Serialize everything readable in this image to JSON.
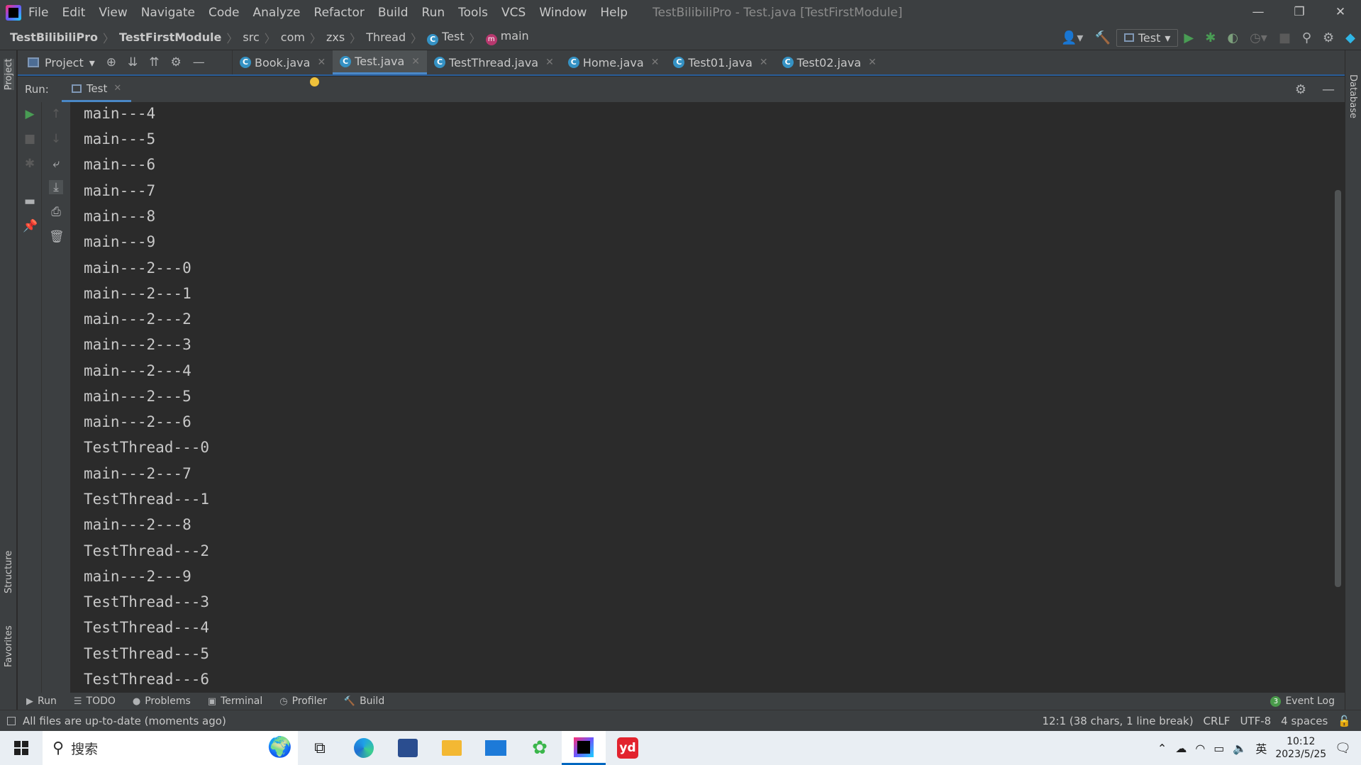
{
  "window": {
    "menu": [
      "File",
      "Edit",
      "View",
      "Navigate",
      "Code",
      "Analyze",
      "Refactor",
      "Build",
      "Run",
      "Tools",
      "VCS",
      "Window",
      "Help"
    ],
    "title": "TestBilibiliPro - Test.java [TestFirstModule]",
    "controls": {
      "minimize": "—",
      "restore": "❐",
      "close": "✕"
    }
  },
  "breadcrumb": {
    "project": "TestBilibiliPro",
    "module": "TestFirstModule",
    "path": [
      "src",
      "com",
      "zxs",
      "Thread"
    ],
    "class": "Test",
    "method": "main"
  },
  "toolbar": {
    "run_config": "Test"
  },
  "project_panel": {
    "label": "Project"
  },
  "editor_tabs": [
    {
      "label": "Book.java",
      "active": false
    },
    {
      "label": "Test.java",
      "active": true
    },
    {
      "label": "TestThread.java",
      "active": false
    },
    {
      "label": "Home.java",
      "active": false
    },
    {
      "label": "Test01.java",
      "active": false
    },
    {
      "label": "Test02.java",
      "active": false
    }
  ],
  "run_panel": {
    "label": "Run:",
    "tab": "Test"
  },
  "console_lines": [
    "main---4",
    "main---5",
    "main---6",
    "main---7",
    "main---8",
    "main---9",
    "main---2---0",
    "main---2---1",
    "main---2---2",
    "main---2---3",
    "main---2---4",
    "main---2---5",
    "main---2---6",
    "TestThread---0",
    "main---2---7",
    "TestThread---1",
    "main---2---8",
    "TestThread---2",
    "main---2---9",
    "TestThread---3",
    "TestThread---4",
    "TestThread---5",
    "TestThread---6"
  ],
  "side_labels": {
    "left_top": "Project",
    "left_structure": "Structure",
    "left_favorites": "Favorites",
    "right": "Database"
  },
  "bottom_tabs": [
    "Run",
    "TODO",
    "Problems",
    "Terminal",
    "Profiler",
    "Build"
  ],
  "event_log": {
    "label": "Event Log",
    "count": "3"
  },
  "status": {
    "message": "All files are up-to-date (moments ago)",
    "position": "12:1 (38 chars, 1 line break)",
    "line_sep": "CRLF",
    "encoding": "UTF-8",
    "indent": "4 spaces"
  },
  "taskbar": {
    "search": "搜索",
    "ime": "英",
    "time": "10:12",
    "date": "2023/5/25"
  },
  "colors": {
    "accent": "#4a88c7",
    "bg": "#2b2b2b",
    "panel": "#3c3f41",
    "run_green": "#499c54"
  }
}
